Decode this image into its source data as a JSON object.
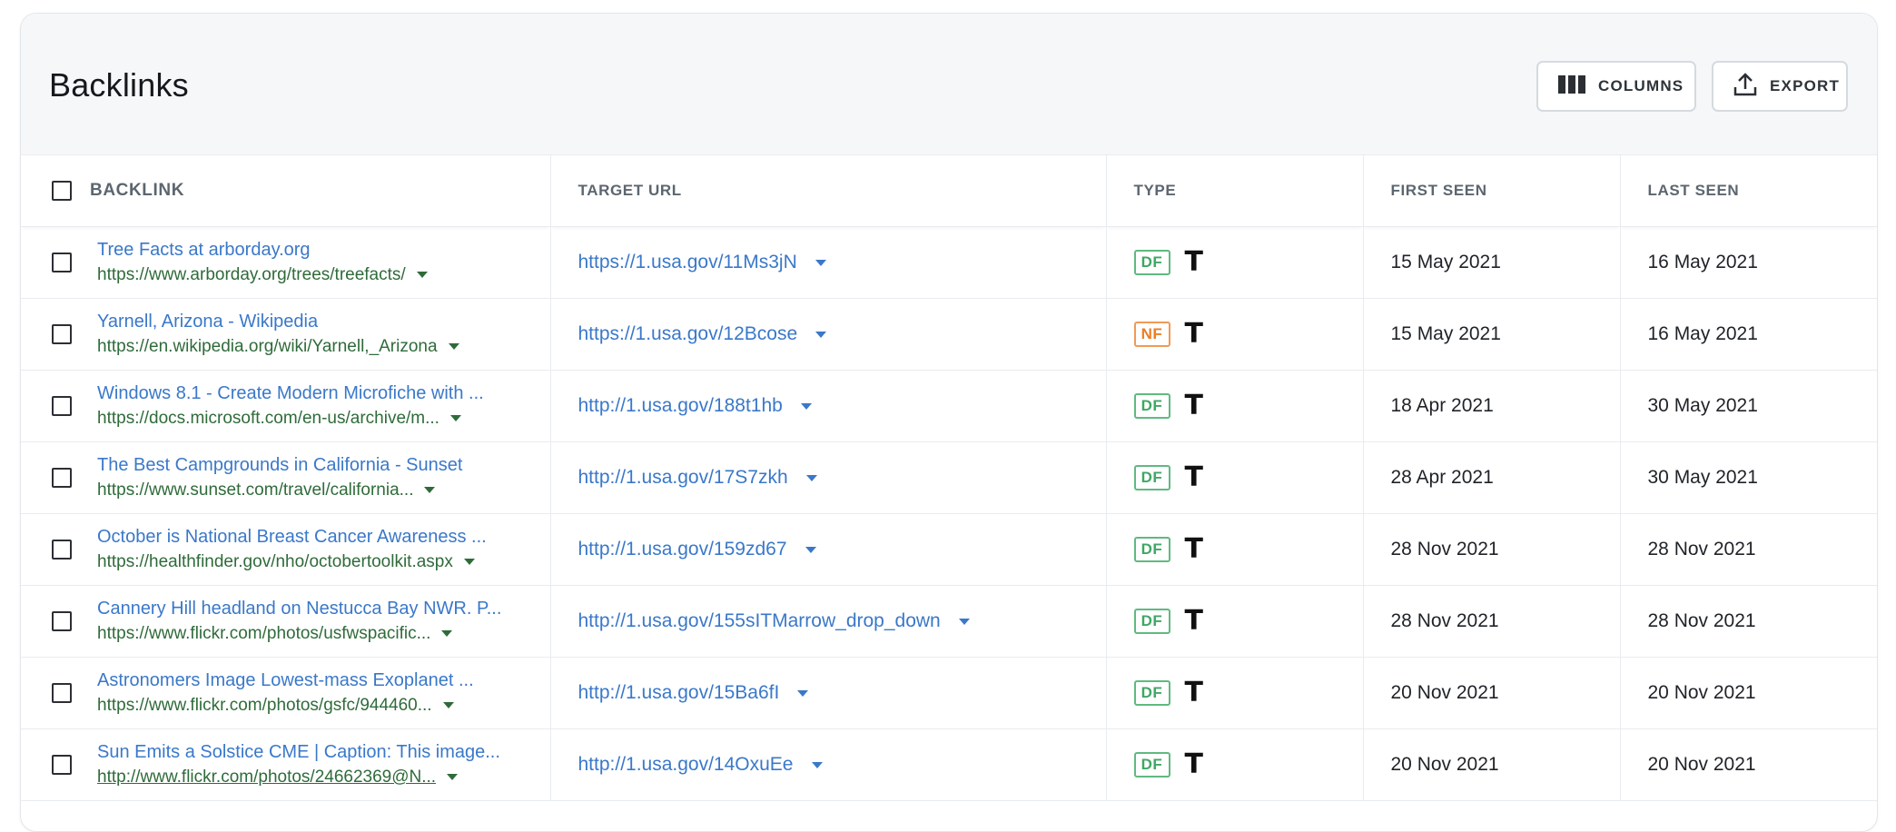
{
  "header": {
    "title": "Backlinks",
    "columns_label": "COLUMNS",
    "export_label": "EXPORT"
  },
  "table": {
    "columns": [
      "BACKLINK",
      "TARGET URL",
      "TYPE",
      "FIRST SEEN",
      "LAST SEEN"
    ],
    "rows": [
      {
        "title": "Tree Facts at arborday.org",
        "url": "https://www.arborday.org/trees/treefacts/",
        "target": "https://1.usa.gov/11Ms3jN",
        "badge": "DF",
        "first_seen": "15 May 2021",
        "last_seen": "16 May 2021"
      },
      {
        "title": "Yarnell, Arizona - Wikipedia",
        "url": "https://en.wikipedia.org/wiki/Yarnell,_Arizona",
        "target": "https://1.usa.gov/12Bcose",
        "badge": "NF",
        "first_seen": "15 May 2021",
        "last_seen": "16 May 2021"
      },
      {
        "title": "Windows 8.1 - Create Modern Microfiche with ...",
        "url": "https://docs.microsoft.com/en-us/archive/m...",
        "target": "http://1.usa.gov/188t1hb",
        "badge": "DF",
        "first_seen": "18 Apr 2021",
        "last_seen": "30 May 2021"
      },
      {
        "title": "The Best Campgrounds in California - Sunset",
        "url": "https://www.sunset.com/travel/california...",
        "target": "http://1.usa.gov/17S7zkh",
        "badge": "DF",
        "first_seen": "28 Apr 2021",
        "last_seen": "30 May 2021"
      },
      {
        "title": "October is National Breast Cancer Awareness ...",
        "url": "https://healthfinder.gov/nho/octobertoolkit.aspx",
        "target": "http://1.usa.gov/159zd67",
        "badge": "DF",
        "first_seen": "28 Nov 2021",
        "last_seen": "28 Nov 2021"
      },
      {
        "title": "Cannery Hill headland on Nestucca Bay NWR. P...",
        "url": "https://www.flickr.com/photos/usfwspacific...",
        "target": "http://1.usa.gov/155sITMarrow_drop_down",
        "badge": "DF",
        "first_seen": "28 Nov 2021",
        "last_seen": "28 Nov 2021"
      },
      {
        "title": "Astronomers Image Lowest-mass Exoplanet ...",
        "url": "https://www.flickr.com/photos/gsfc/944460...",
        "target": "http://1.usa.gov/15Ba6fI",
        "badge": "DF",
        "first_seen": "20 Nov 2021",
        "last_seen": "20 Nov 2021"
      },
      {
        "title": "Sun Emits a Solstice CME | Caption: This image...",
        "url": "http://www.flickr.com/photos/24662369@N...",
        "target": "http://1.usa.gov/14OxuEe",
        "badge": "DF",
        "first_seen": "20 Nov 2021",
        "last_seen": "20 Nov 2021"
      }
    ]
  },
  "type_icon_text": "T",
  "colors": {
    "link_blue": "#3a78c9",
    "url_green": "#2f6b3a",
    "dofollow_green": "#3fa764",
    "nofollow_orange": "#ec7d24"
  },
  "icons": {
    "columns": "columns-icon",
    "export": "upload-icon",
    "caret": "caret-down-icon",
    "type_text": "text-type-icon"
  }
}
